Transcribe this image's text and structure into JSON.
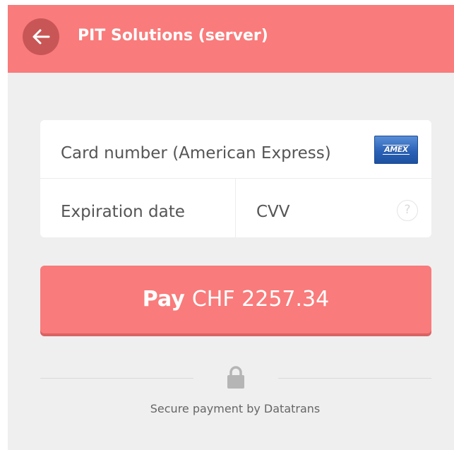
{
  "header": {
    "title": "PIT Solutions (server)",
    "back_icon": "arrow-left-icon"
  },
  "card_form": {
    "card_number_label": "Card number (American Express)",
    "card_brand": "AMEX",
    "expiration_label": "Expiration date",
    "cvv_label": "CVV",
    "cvv_help_glyph": "?"
  },
  "pay_button": {
    "label": "Pay",
    "amount": "CHF 2257.34"
  },
  "footer": {
    "lock_icon": "lock-icon",
    "secure_text": "Secure payment by Datatrans"
  },
  "colors": {
    "accent": "#f97b7b",
    "back_button_bg": "#c95656",
    "page_bg": "#efefef",
    "card_bg": "#ffffff",
    "lock": "#b5b5b5"
  }
}
